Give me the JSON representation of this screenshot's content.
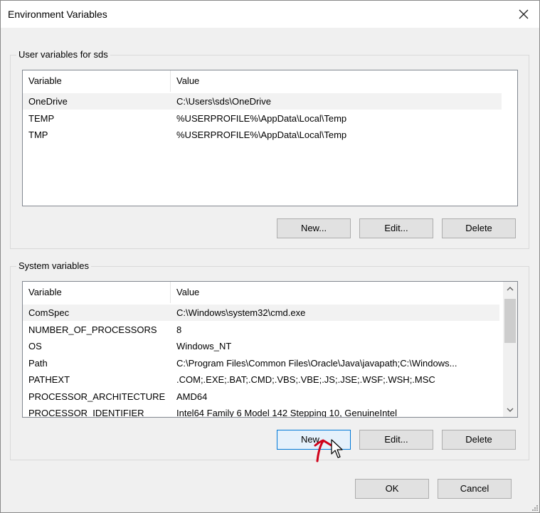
{
  "window": {
    "title": "Environment Variables",
    "close_glyph": "✕"
  },
  "user_section": {
    "label": "User variables for sds",
    "columns": [
      "Variable",
      "Value"
    ],
    "rows": [
      {
        "variable": "OneDrive",
        "value": "C:\\Users\\sds\\OneDrive",
        "selected": true
      },
      {
        "variable": "TEMP",
        "value": "%USERPROFILE%\\AppData\\Local\\Temp",
        "selected": false
      },
      {
        "variable": "TMP",
        "value": "%USERPROFILE%\\AppData\\Local\\Temp",
        "selected": false
      }
    ],
    "buttons": {
      "new": "New...",
      "edit": "Edit...",
      "delete": "Delete"
    }
  },
  "system_section": {
    "label": "System variables",
    "columns": [
      "Variable",
      "Value"
    ],
    "rows": [
      {
        "variable": "ComSpec",
        "value": "C:\\Windows\\system32\\cmd.exe",
        "selected": true
      },
      {
        "variable": "NUMBER_OF_PROCESSORS",
        "value": "8",
        "selected": false
      },
      {
        "variable": "OS",
        "value": "Windows_NT",
        "selected": false
      },
      {
        "variable": "Path",
        "value": "C:\\Program Files\\Common Files\\Oracle\\Java\\javapath;C:\\Windows...",
        "selected": false
      },
      {
        "variable": "PATHEXT",
        "value": ".COM;.EXE;.BAT;.CMD;.VBS;.VBE;.JS;.JSE;.WSF;.WSH;.MSC",
        "selected": false
      },
      {
        "variable": "PROCESSOR_ARCHITECTURE",
        "value": "AMD64",
        "selected": false
      },
      {
        "variable": "PROCESSOR_IDENTIFIER",
        "value": "Intel64 Family 6 Model 142 Stepping 10, GenuineIntel",
        "selected": false
      }
    ],
    "buttons": {
      "new": "New...",
      "edit": "Edit...",
      "delete": "Delete"
    },
    "icons": {
      "scroll_up": "chevron-up-icon",
      "scroll_down": "chevron-down-icon"
    }
  },
  "footer": {
    "ok": "OK",
    "cancel": "Cancel"
  },
  "colors": {
    "dialog_bg": "#f0f0f0",
    "focus_border": "#0078d7",
    "annotation": "#d0021b"
  }
}
